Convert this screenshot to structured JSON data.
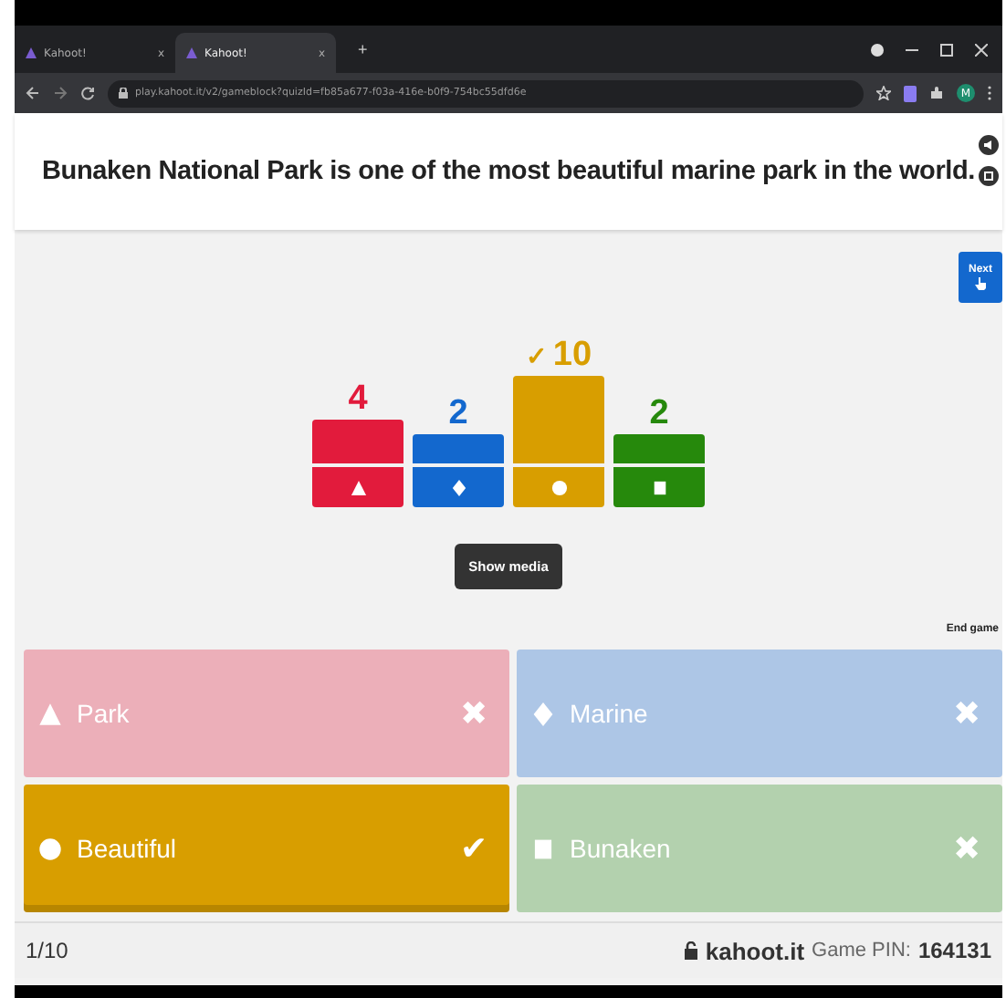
{
  "browser": {
    "tabs": [
      {
        "title": "Kahoot!",
        "selected": false,
        "close": "x"
      },
      {
        "title": "Kahoot!",
        "selected": true,
        "close": "x"
      }
    ],
    "new_tab": "+",
    "url": "play.kahoot.it/v2/gameblock?quizId=fb85a677-f03a-416e-b0f9-754bc55dfd6e",
    "profile": "M"
  },
  "question": "Bunaken National Park is one of the most beautiful marine park in the world.",
  "next_button": "Next",
  "results": [
    {
      "count": "4",
      "kind": "triangle",
      "color": "#e21b3c"
    },
    {
      "count": "2",
      "kind": "diamond",
      "color": "#1368ce"
    },
    {
      "count": "10",
      "kind": "circle",
      "color": "#d89e00",
      "check": "✓"
    },
    {
      "count": "2",
      "kind": "square",
      "color": "#26890c"
    }
  ],
  "show_media": "Show media",
  "end_game": "End game",
  "answers": [
    {
      "text": "Park",
      "kind": "triangle",
      "color": "#ecafb9",
      "correct": false,
      "mark": "✖"
    },
    {
      "text": "Marine",
      "kind": "diamond",
      "color": "#adc6e6",
      "correct": false,
      "mark": "✖"
    },
    {
      "text": "Beautiful",
      "kind": "circle",
      "color": "#d89e00",
      "correct": true,
      "mark": "✔"
    },
    {
      "text": "Bunaken",
      "kind": "square",
      "color": "#b3d1ae",
      "correct": false,
      "mark": "✖"
    }
  ],
  "footer": {
    "progress": "1/10",
    "site": "kahoot.it",
    "pin_label": "Game PIN:",
    "pin": "164131"
  }
}
